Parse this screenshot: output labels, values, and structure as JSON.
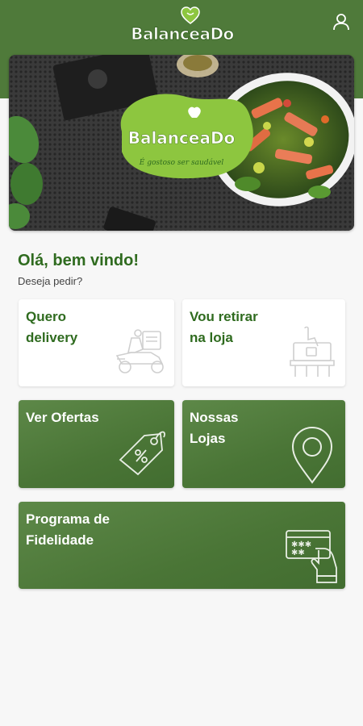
{
  "app": {
    "logo_text": "BalanceaDo",
    "logo_tagline": "É gostoso ser saudável"
  },
  "header": {
    "user_icon": "user-icon"
  },
  "banner": {
    "logo_text": "BalanceaDo",
    "tagline": "É gostoso ser saudável"
  },
  "greeting": {
    "title": "Olá, bem vindo!",
    "subtitle": "Deseja pedir?"
  },
  "options": {
    "delivery": {
      "label": "Quero\ndelivery",
      "icon": "delivery-scooter-icon"
    },
    "pickup": {
      "label": "Vou retirar\nna loja",
      "icon": "store-pickup-icon"
    },
    "offers": {
      "label": "Ver Ofertas",
      "icon": "price-tag-icon"
    },
    "stores": {
      "label": "Nossas\nLojas",
      "icon": "map-pin-icon"
    },
    "loyalty": {
      "label": "Programa de\nFidelidade",
      "icon": "loyalty-card-icon"
    }
  },
  "colors": {
    "brand_green": "#4f7a3a",
    "text_green": "#2f6b1f",
    "logo_green": "#8dc63f"
  }
}
